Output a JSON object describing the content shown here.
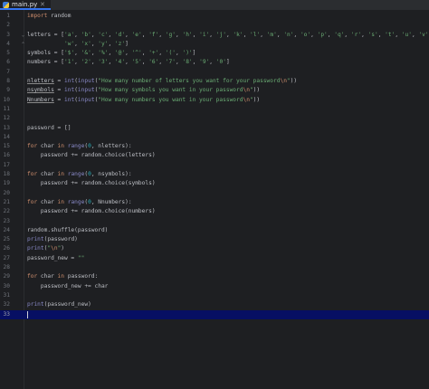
{
  "editor": {
    "tab": {
      "filename": "main.py",
      "close_glyph": "✕",
      "icon": "python-file-icon"
    },
    "current_line": 33,
    "lines": [
      {
        "n": "1",
        "tokens": [
          [
            "kw",
            "import"
          ],
          [
            "id",
            " random"
          ]
        ]
      },
      {
        "n": "2",
        "tokens": []
      },
      {
        "n": "3",
        "fold": "open",
        "tokens": [
          [
            "id",
            "letters = ["
          ],
          [
            "str",
            "'a'"
          ],
          [
            "id",
            ", "
          ],
          [
            "str",
            "'b'"
          ],
          [
            "id",
            ", "
          ],
          [
            "str",
            "'c'"
          ],
          [
            "id",
            ", "
          ],
          [
            "str",
            "'d'"
          ],
          [
            "id",
            ", "
          ],
          [
            "str",
            "'e'"
          ],
          [
            "id",
            ", "
          ],
          [
            "str",
            "'f'"
          ],
          [
            "id",
            ", "
          ],
          [
            "str",
            "'g'"
          ],
          [
            "id",
            ", "
          ],
          [
            "str",
            "'h'"
          ],
          [
            "id",
            ", "
          ],
          [
            "str",
            "'i'"
          ],
          [
            "id",
            ", "
          ],
          [
            "str",
            "'j'"
          ],
          [
            "id",
            ", "
          ],
          [
            "str",
            "'k'"
          ],
          [
            "id",
            ", "
          ],
          [
            "str",
            "'l'"
          ],
          [
            "id",
            ", "
          ],
          [
            "str",
            "'m'"
          ],
          [
            "id",
            ", "
          ],
          [
            "str",
            "'n'"
          ],
          [
            "id",
            ", "
          ],
          [
            "str",
            "'o'"
          ],
          [
            "id",
            ", "
          ],
          [
            "str",
            "'p'"
          ],
          [
            "id",
            ", "
          ],
          [
            "str",
            "'q'"
          ],
          [
            "id",
            ", "
          ],
          [
            "str",
            "'r'"
          ],
          [
            "id",
            ", "
          ],
          [
            "str",
            "'s'"
          ],
          [
            "id",
            ", "
          ],
          [
            "str",
            "'t'"
          ],
          [
            "id",
            ", "
          ],
          [
            "str",
            "'u'"
          ],
          [
            "id",
            ", "
          ],
          [
            "str",
            "'v'"
          ],
          [
            "id",
            ","
          ]
        ]
      },
      {
        "n": "4",
        "fold": "close",
        "tokens": [
          [
            "id",
            "           "
          ],
          [
            "str",
            "'w'"
          ],
          [
            "id",
            ", "
          ],
          [
            "str",
            "'x'"
          ],
          [
            "id",
            ", "
          ],
          [
            "str",
            "'y'"
          ],
          [
            "id",
            ", "
          ],
          [
            "str",
            "'z'"
          ],
          [
            "id",
            "]"
          ]
        ]
      },
      {
        "n": "5",
        "tokens": [
          [
            "id",
            "symbols = ["
          ],
          [
            "str",
            "'$'"
          ],
          [
            "id",
            ", "
          ],
          [
            "str",
            "'&'"
          ],
          [
            "id",
            ", "
          ],
          [
            "str",
            "'%'"
          ],
          [
            "id",
            ", "
          ],
          [
            "str",
            "'@'"
          ],
          [
            "id",
            ", "
          ],
          [
            "str",
            "'^'"
          ],
          [
            "id",
            ", "
          ],
          [
            "str",
            "'+'"
          ],
          [
            "id",
            ", "
          ],
          [
            "str",
            "'('"
          ],
          [
            "id",
            ", "
          ],
          [
            "str",
            "')'"
          ],
          [
            "id",
            "]"
          ]
        ]
      },
      {
        "n": "6",
        "tokens": [
          [
            "id",
            "numbers = ["
          ],
          [
            "str",
            "'1'"
          ],
          [
            "id",
            ", "
          ],
          [
            "str",
            "'2'"
          ],
          [
            "id",
            ", "
          ],
          [
            "str",
            "'3'"
          ],
          [
            "id",
            ", "
          ],
          [
            "str",
            "'4'"
          ],
          [
            "id",
            ", "
          ],
          [
            "str",
            "'5'"
          ],
          [
            "id",
            ", "
          ],
          [
            "str",
            "'6'"
          ],
          [
            "id",
            ", "
          ],
          [
            "str",
            "'7'"
          ],
          [
            "id",
            ", "
          ],
          [
            "str",
            "'8'"
          ],
          [
            "id",
            ", "
          ],
          [
            "str",
            "'9'"
          ],
          [
            "id",
            ", "
          ],
          [
            "str",
            "'0'"
          ],
          [
            "id",
            "]"
          ]
        ]
      },
      {
        "n": "7",
        "tokens": []
      },
      {
        "n": "8",
        "tokens": [
          [
            "ul",
            "nletters"
          ],
          [
            "id",
            " = "
          ],
          [
            "bi",
            "int"
          ],
          [
            "id",
            "("
          ],
          [
            "bi",
            "input"
          ],
          [
            "id",
            "("
          ],
          [
            "str",
            "\"How many number of letters you want for your password"
          ],
          [
            "esc",
            "\\n"
          ],
          [
            "str",
            "\""
          ],
          [
            "id",
            "))"
          ]
        ]
      },
      {
        "n": "9",
        "tokens": [
          [
            "ul",
            "nsymbols"
          ],
          [
            "id",
            " = "
          ],
          [
            "bi",
            "int"
          ],
          [
            "id",
            "("
          ],
          [
            "bi",
            "input"
          ],
          [
            "id",
            "("
          ],
          [
            "str",
            "\"How many symbols you want in your password"
          ],
          [
            "esc",
            "\\n"
          ],
          [
            "str",
            "\""
          ],
          [
            "id",
            "))"
          ]
        ]
      },
      {
        "n": "10",
        "tokens": [
          [
            "ul",
            "Nnumbers"
          ],
          [
            "id",
            " = "
          ],
          [
            "bi",
            "int"
          ],
          [
            "id",
            "("
          ],
          [
            "bi",
            "input"
          ],
          [
            "id",
            "("
          ],
          [
            "str",
            "\"How many numbers you want in your password"
          ],
          [
            "esc",
            "\\n"
          ],
          [
            "str",
            "\""
          ],
          [
            "id",
            "))"
          ]
        ]
      },
      {
        "n": "11",
        "tokens": []
      },
      {
        "n": "12",
        "tokens": []
      },
      {
        "n": "13",
        "tokens": [
          [
            "id",
            "password = []"
          ]
        ]
      },
      {
        "n": "14",
        "tokens": []
      },
      {
        "n": "15",
        "tokens": [
          [
            "kw",
            "for"
          ],
          [
            "id",
            " char "
          ],
          [
            "kw",
            "in"
          ],
          [
            "id",
            " "
          ],
          [
            "bi",
            "range"
          ],
          [
            "id",
            "("
          ],
          [
            "num",
            "0"
          ],
          [
            "id",
            ", nletters):"
          ]
        ]
      },
      {
        "n": "16",
        "tokens": [
          [
            "id",
            "    password += random.choice(letters)"
          ]
        ]
      },
      {
        "n": "17",
        "tokens": []
      },
      {
        "n": "18",
        "tokens": [
          [
            "kw",
            "for"
          ],
          [
            "id",
            " char "
          ],
          [
            "kw",
            "in"
          ],
          [
            "id",
            " "
          ],
          [
            "bi",
            "range"
          ],
          [
            "id",
            "("
          ],
          [
            "num",
            "0"
          ],
          [
            "id",
            ", nsymbols):"
          ]
        ]
      },
      {
        "n": "19",
        "tokens": [
          [
            "id",
            "    password += random.choice(symbols)"
          ]
        ]
      },
      {
        "n": "20",
        "tokens": []
      },
      {
        "n": "21",
        "tokens": [
          [
            "kw",
            "for"
          ],
          [
            "id",
            " char "
          ],
          [
            "kw",
            "in"
          ],
          [
            "id",
            " "
          ],
          [
            "bi",
            "range"
          ],
          [
            "id",
            "("
          ],
          [
            "num",
            "0"
          ],
          [
            "id",
            ", Nnumbers):"
          ]
        ]
      },
      {
        "n": "22",
        "tokens": [
          [
            "id",
            "    password += random.choice(numbers)"
          ]
        ]
      },
      {
        "n": "23",
        "tokens": []
      },
      {
        "n": "24",
        "tokens": [
          [
            "id",
            "random.shuffle(password)"
          ]
        ]
      },
      {
        "n": "25",
        "tokens": [
          [
            "bi",
            "print"
          ],
          [
            "id",
            "(password)"
          ]
        ]
      },
      {
        "n": "26",
        "tokens": [
          [
            "bi",
            "print"
          ],
          [
            "id",
            "("
          ],
          [
            "str",
            "\""
          ],
          [
            "esc",
            "\\n"
          ],
          [
            "str",
            "\""
          ],
          [
            "id",
            ")"
          ]
        ]
      },
      {
        "n": "27",
        "tokens": [
          [
            "id",
            "password_new = "
          ],
          [
            "str",
            "\"\""
          ]
        ]
      },
      {
        "n": "28",
        "tokens": []
      },
      {
        "n": "29",
        "tokens": [
          [
            "kw",
            "for"
          ],
          [
            "id",
            " char "
          ],
          [
            "kw",
            "in"
          ],
          [
            "id",
            " password:"
          ]
        ]
      },
      {
        "n": "30",
        "tokens": [
          [
            "id",
            "    password_new += char"
          ]
        ]
      },
      {
        "n": "31",
        "tokens": []
      },
      {
        "n": "32",
        "tokens": [
          [
            "bi",
            "print"
          ],
          [
            "id",
            "(password_new)"
          ]
        ]
      },
      {
        "n": "33",
        "tokens": []
      }
    ]
  },
  "colors": {
    "background": "#1e1f22",
    "current_line": "#070f63",
    "keyword": "#cf8e6d",
    "string": "#6aab73",
    "number": "#2aacb8",
    "builtin": "#8888c6",
    "identifier": "#bcbec4",
    "line_number": "#6f737a"
  }
}
